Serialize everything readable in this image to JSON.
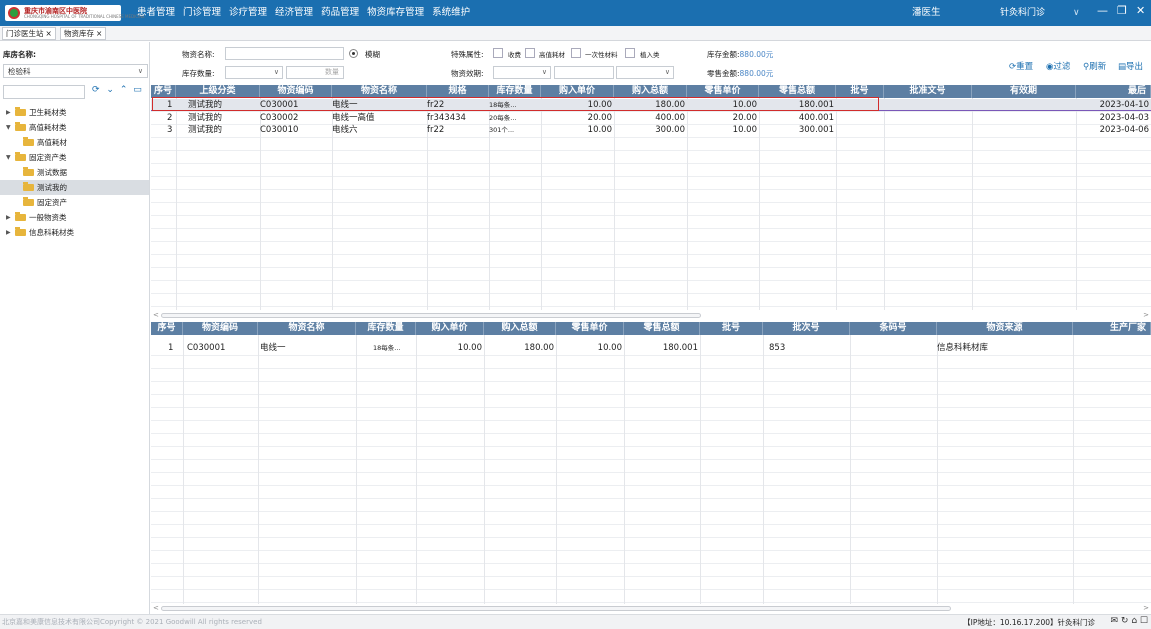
{
  "app": {
    "logo_title": "重庆市渝南区中医院",
    "logo_sub": "CHONGQING HOSPITAL OF TRADITIONAL CHINESE MEDICINE",
    "menu": [
      "患者管理",
      "门诊管理",
      "诊疗管理",
      "经济管理",
      "药品管理",
      "物资库存管理",
      "系统维护"
    ],
    "user": "潘医生",
    "dept": "针灸科门诊",
    "dept_arrow": "∨",
    "win_min": "—",
    "win_restore": "❐",
    "win_close": "✕"
  },
  "tabs": [
    {
      "label": "门诊医生站",
      "close": "×"
    },
    {
      "label": "物资库存",
      "close": "×"
    }
  ],
  "sidebar": {
    "warehouse_label": "库房名称:",
    "warehouse_value": "检验科",
    "search_placeholder": "",
    "tree": [
      {
        "label": "卫生耗材类",
        "level": 0,
        "expanded": false,
        "toggle": "▶"
      },
      {
        "label": "高值耗材类",
        "level": 0,
        "expanded": true,
        "toggle": "▼"
      },
      {
        "label": "高值耗材",
        "level": 1,
        "toggle": ""
      },
      {
        "label": "固定资产类",
        "level": 0,
        "expanded": true,
        "toggle": "▼"
      },
      {
        "label": "测试数据",
        "level": 1,
        "toggle": ""
      },
      {
        "label": "测试我的",
        "level": 1,
        "selected": true,
        "toggle": ""
      },
      {
        "label": "固定资产",
        "level": 1,
        "toggle": ""
      },
      {
        "label": "一般物资类",
        "level": 0,
        "expanded": false,
        "toggle": "▶"
      },
      {
        "label": "信息科耗材类",
        "level": 0,
        "expanded": false,
        "toggle": "▶"
      }
    ]
  },
  "filter": {
    "name_label": "物资名称:",
    "fuzzy_label": "模糊",
    "qty_label": "库存数量:",
    "qty_placeholder": "数量",
    "attr_label": "特殊属性:",
    "attr_options": [
      "收费",
      "高值耗材",
      "一次性材料",
      "植入类"
    ],
    "expiry_label": "物资效期:",
    "stock_amount_label": "库存金额:",
    "stock_amount_value": "880.00元",
    "retail_amount_label": "零售金额:",
    "retail_amount_value": "880.00元",
    "reset": "重置",
    "filter": "过滤",
    "refresh": "刷新",
    "export": "导出"
  },
  "upper_table": {
    "columns": [
      "序号",
      "上级分类",
      "物资编码",
      "物资名称",
      "规格",
      "库存数量",
      "购入单价",
      "购入总额",
      "零售单价",
      "零售总额",
      "批号",
      "批准文号",
      "有效期",
      "最后"
    ],
    "rows": [
      [
        "1",
        "测试我的",
        "C030001",
        "电线一",
        "fr22",
        "18每条...",
        "10.00",
        "180.00",
        "10.00",
        "180.001",
        "",
        "",
        "",
        "2023-04-10"
      ],
      [
        "2",
        "测试我的",
        "C030002",
        "电线一高值",
        "fr343434",
        "20每条...",
        "20.00",
        "400.00",
        "20.00",
        "400.001",
        "",
        "",
        "",
        "2023-04-03"
      ],
      [
        "3",
        "测试我的",
        "C030010",
        "电线六",
        "fr22",
        "301个...",
        "10.00",
        "300.00",
        "10.00",
        "300.001",
        "",
        "",
        "",
        "2023-04-06"
      ]
    ]
  },
  "lower_table": {
    "columns": [
      "序号",
      "物资编码",
      "物资名称",
      "库存数量",
      "购入单价",
      "购入总额",
      "零售单价",
      "零售总额",
      "批号",
      "批次号",
      "条码号",
      "物资来源",
      "生产厂家"
    ],
    "rows": [
      [
        "1",
        "C030001",
        "电线一",
        "18每条...",
        "10.00",
        "180.00",
        "10.00",
        "180.001",
        "",
        "853",
        "",
        "信息科耗材库",
        ""
      ]
    ]
  },
  "scroll": {
    "left": "<",
    "right": ">"
  },
  "footer": {
    "copyright": "北京嘉和美康信息技术有限公司Copyright © 2021 Goodwill All rights reserved",
    "status": "【IP地址：10.16.17.200】针灸科门诊"
  }
}
